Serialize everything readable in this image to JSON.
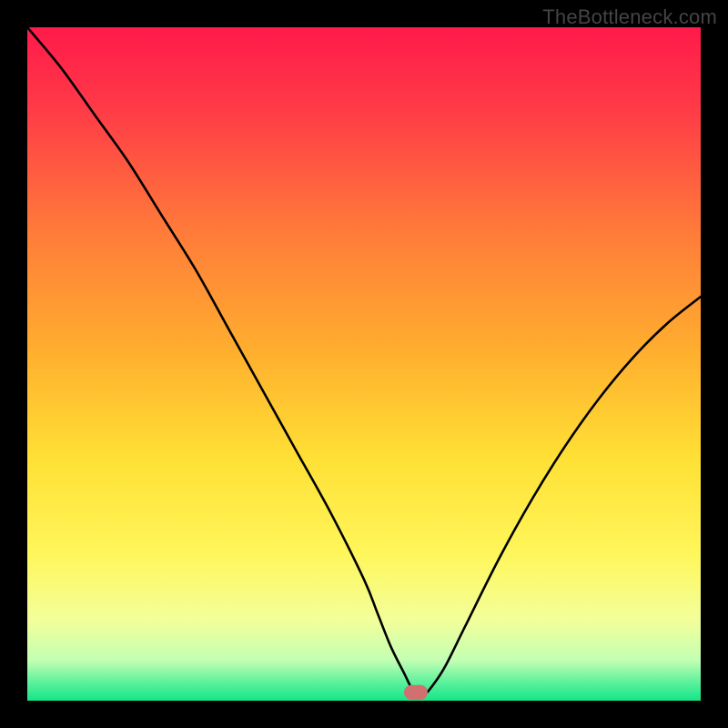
{
  "watermark": {
    "text": "TheBottleneck.com"
  },
  "icons": {
    "marker": "marker-icon"
  },
  "chart_data": {
    "type": "line",
    "title": "",
    "xlabel": "",
    "ylabel": "",
    "xlim": [
      0,
      100
    ],
    "ylim": [
      0,
      100
    ],
    "grid": false,
    "legend": null,
    "gradient_stops": [
      {
        "offset": 0.0,
        "color": "#ff1a4b"
      },
      {
        "offset": 0.12,
        "color": "#ff3a47"
      },
      {
        "offset": 0.3,
        "color": "#ff7a3a"
      },
      {
        "offset": 0.48,
        "color": "#ffae2e"
      },
      {
        "offset": 0.64,
        "color": "#ffe035"
      },
      {
        "offset": 0.78,
        "color": "#fff65a"
      },
      {
        "offset": 0.88,
        "color": "#f3ff9a"
      },
      {
        "offset": 0.94,
        "color": "#c3ffb3"
      },
      {
        "offset": 0.975,
        "color": "#56f09a"
      },
      {
        "offset": 1.0,
        "color": "#15e588"
      }
    ],
    "series": [
      {
        "name": "bottleneck-curve",
        "x": [
          0,
          5,
          10,
          15,
          20,
          25,
          30,
          35,
          40,
          45,
          50,
          52,
          54,
          56,
          57,
          58,
          59,
          60,
          62,
          65,
          70,
          75,
          80,
          85,
          90,
          95,
          100
        ],
        "values": [
          100,
          94,
          87,
          80,
          72,
          64,
          55,
          46,
          37,
          28,
          18,
          13,
          8,
          4,
          2,
          1,
          1,
          2,
          5,
          11,
          21,
          30,
          38,
          45,
          51,
          56,
          60
        ]
      }
    ],
    "marker": {
      "x": 57.7,
      "width": 3.5,
      "height": 2.2,
      "color": "#d07070",
      "radius": 1.3
    }
  }
}
